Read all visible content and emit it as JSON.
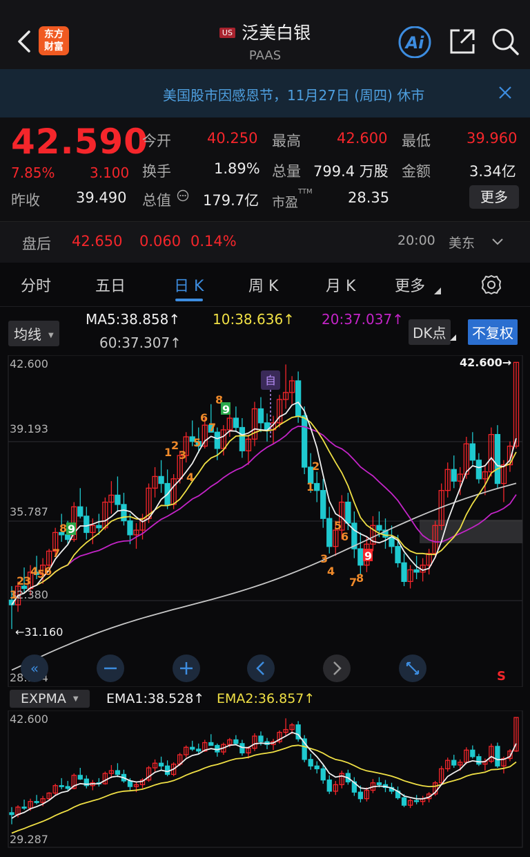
{
  "header": {
    "logo_line1": "东方",
    "logo_line2": "财富",
    "market_badge": "US",
    "title": "泛美白银",
    "subtitle": "PAAS",
    "ai_label": "Ai"
  },
  "notice": {
    "text": "美国股市因感恩节，11月27日 (周四) 休市"
  },
  "quote": {
    "price": "42.590",
    "change_pct": "7.85%",
    "change": "3.100",
    "prev_close_label": "昨收",
    "prev_close": "39.490",
    "open_label": "今开",
    "open": "40.250",
    "high_label": "最高",
    "high": "42.600",
    "low_label": "最低",
    "low": "39.960",
    "turnover_label": "换手",
    "turnover": "1.89%",
    "volume_label": "总量",
    "volume": "799.4 万股",
    "amount_label": "金额",
    "amount": "3.34亿",
    "mktcap_label": "总值",
    "mktcap": "179.7亿",
    "pe_label": "市盈",
    "pe_sup": "TTM",
    "pe": "28.35",
    "more": "更多"
  },
  "after_hours": {
    "label": "盘后",
    "price": "42.650",
    "change": "0.060",
    "pct": "0.14%",
    "time": "20:00",
    "tz": "美东"
  },
  "tabs": [
    "分时",
    "五日",
    "日 K",
    "周 K",
    "月 K",
    "更多"
  ],
  "ma_bar": {
    "dropdown": "均线",
    "ma5": "MA5:38.858",
    "ma10": "10:38.636",
    "ma20": "20:37.037",
    "ma60": "60:37.307",
    "dk": "DK点",
    "adjust": "不复权",
    "arrow": "↑"
  },
  "main_chart": {
    "y_labels": [
      "42.600",
      "39.193",
      "35.787",
      "32.380",
      "28.974"
    ],
    "max_marker": "42.600→",
    "min_marker": "←31.160",
    "self_tag": "自",
    "s_tag": "S"
  },
  "ema_bar": {
    "dropdown": "EXPMA",
    "ema1": "EMA1:38.528",
    "ema2": "EMA2:36.857",
    "arrow": "↑"
  },
  "sub_chart": {
    "y_labels": [
      "42.600",
      "29.287"
    ]
  },
  "colors": {
    "up": "#f5262b",
    "down": "#1fc9cf",
    "ma5": "#f0f0f0",
    "ma10": "#f0e045",
    "ma20": "#c424c8",
    "ma60": "#c8c8c8",
    "accent": "#3d8de0"
  },
  "chart_data": {
    "type": "candlestick",
    "ylim": [
      28.974,
      42.6
    ],
    "candles": [
      [
        32.4,
        33.0,
        31.16,
        32.2
      ],
      [
        32.2,
        33.2,
        31.9,
        33.0
      ],
      [
        33.0,
        33.8,
        32.7,
        32.9
      ],
      [
        32.9,
        33.9,
        32.6,
        33.6
      ],
      [
        33.6,
        34.3,
        33.3,
        33.5
      ],
      [
        33.5,
        34.2,
        33.1,
        33.9
      ],
      [
        33.9,
        34.6,
        33.7,
        34.5
      ],
      [
        34.5,
        35.5,
        34.3,
        35.3
      ],
      [
        35.3,
        36.1,
        34.9,
        35.2
      ],
      [
        35.2,
        35.8,
        34.8,
        35.0
      ],
      [
        35.0,
        36.6,
        34.9,
        36.4
      ],
      [
        36.4,
        37.2,
        35.9,
        36.0
      ],
      [
        36.0,
        36.4,
        35.0,
        35.3
      ],
      [
        35.3,
        35.9,
        34.8,
        35.6
      ],
      [
        35.6,
        36.1,
        35.2,
        35.5
      ],
      [
        35.5,
        36.8,
        35.4,
        36.6
      ],
      [
        36.6,
        37.5,
        36.1,
        36.9
      ],
      [
        36.9,
        37.7,
        36.2,
        36.5
      ],
      [
        36.5,
        37.0,
        35.6,
        35.8
      ],
      [
        35.8,
        36.1,
        34.8,
        35.2
      ],
      [
        35.2,
        35.7,
        34.6,
        35.4
      ],
      [
        35.4,
        36.1,
        35.0,
        35.9
      ],
      [
        35.9,
        37.4,
        35.7,
        37.2
      ],
      [
        37.2,
        38.1,
        36.8,
        37.7
      ],
      [
        37.7,
        38.4,
        37.0,
        37.4
      ],
      [
        37.4,
        38.0,
        36.3,
        36.5
      ],
      [
        36.5,
        37.8,
        36.3,
        37.6
      ],
      [
        37.6,
        38.8,
        37.4,
        38.6
      ],
      [
        38.6,
        39.6,
        38.3,
        39.4
      ],
      [
        39.4,
        40.1,
        39.0,
        39.2
      ],
      [
        39.2,
        39.8,
        38.7,
        39.0
      ],
      [
        39.0,
        40.2,
        38.9,
        39.9
      ],
      [
        39.9,
        40.8,
        39.6,
        39.6
      ],
      [
        39.6,
        39.8,
        38.4,
        38.9
      ],
      [
        38.9,
        39.9,
        38.6,
        39.7
      ],
      [
        39.7,
        40.4,
        39.4,
        40.2
      ],
      [
        40.2,
        40.7,
        39.6,
        39.8
      ],
      [
        39.8,
        40.2,
        38.5,
        38.8
      ],
      [
        38.8,
        39.5,
        38.2,
        39.3
      ],
      [
        39.3,
        40.9,
        39.0,
        40.6
      ],
      [
        40.6,
        41.1,
        39.6,
        40.0
      ],
      [
        40.0,
        40.4,
        39.2,
        39.7
      ],
      [
        39.7,
        40.3,
        39.1,
        40.0
      ],
      [
        40.0,
        41.2,
        39.8,
        41.0
      ],
      [
        41.0,
        42.5,
        40.6,
        41.3
      ],
      [
        41.3,
        42.0,
        40.8,
        41.8
      ],
      [
        41.8,
        42.2,
        40.0,
        40.3
      ],
      [
        40.3,
        40.7,
        37.8,
        38.1
      ],
      [
        38.1,
        38.7,
        37.0,
        37.4
      ],
      [
        37.4,
        37.9,
        36.6,
        37.1
      ],
      [
        37.1,
        37.6,
        35.5,
        35.9
      ],
      [
        35.9,
        36.4,
        34.4,
        34.7
      ],
      [
        34.7,
        35.8,
        34.3,
        35.4
      ],
      [
        35.4,
        36.9,
        35.0,
        36.6
      ],
      [
        36.6,
        37.0,
        35.4,
        35.7
      ],
      [
        35.7,
        36.2,
        34.2,
        34.6
      ],
      [
        34.6,
        35.3,
        33.5,
        33.9
      ],
      [
        33.9,
        35.1,
        33.6,
        34.8
      ],
      [
        34.8,
        36.0,
        34.5,
        35.6
      ],
      [
        35.6,
        36.2,
        35.1,
        35.4
      ],
      [
        35.4,
        35.9,
        34.6,
        35.1
      ],
      [
        35.1,
        35.6,
        34.4,
        34.7
      ],
      [
        34.7,
        35.2,
        33.8,
        34.0
      ],
      [
        34.0,
        34.4,
        33.0,
        33.2
      ],
      [
        33.2,
        33.9,
        32.9,
        33.7
      ],
      [
        33.7,
        34.3,
        33.3,
        33.6
      ],
      [
        33.6,
        34.2,
        33.2,
        33.9
      ],
      [
        33.9,
        34.6,
        33.5,
        34.4
      ],
      [
        34.4,
        35.8,
        34.2,
        35.6
      ],
      [
        35.6,
        37.4,
        35.4,
        37.1
      ],
      [
        37.1,
        38.3,
        36.8,
        38.0
      ],
      [
        38.0,
        38.6,
        37.2,
        37.5
      ],
      [
        37.5,
        38.1,
        36.9,
        37.8
      ],
      [
        37.8,
        39.4,
        37.6,
        39.1
      ],
      [
        39.1,
        39.6,
        38.2,
        38.4
      ],
      [
        38.4,
        38.7,
        37.4,
        37.6
      ],
      [
        37.6,
        38.2,
        36.9,
        37.9
      ],
      [
        37.9,
        39.8,
        37.7,
        39.5
      ],
      [
        39.5,
        39.9,
        37.2,
        37.4
      ],
      [
        37.4,
        38.4,
        36.6,
        38.2
      ],
      [
        38.2,
        39.2,
        37.9,
        39.0
      ],
      [
        39.0,
        42.6,
        38.9,
        42.59
      ]
    ],
    "ema_period_short": 5,
    "ema_period_long": 20
  }
}
